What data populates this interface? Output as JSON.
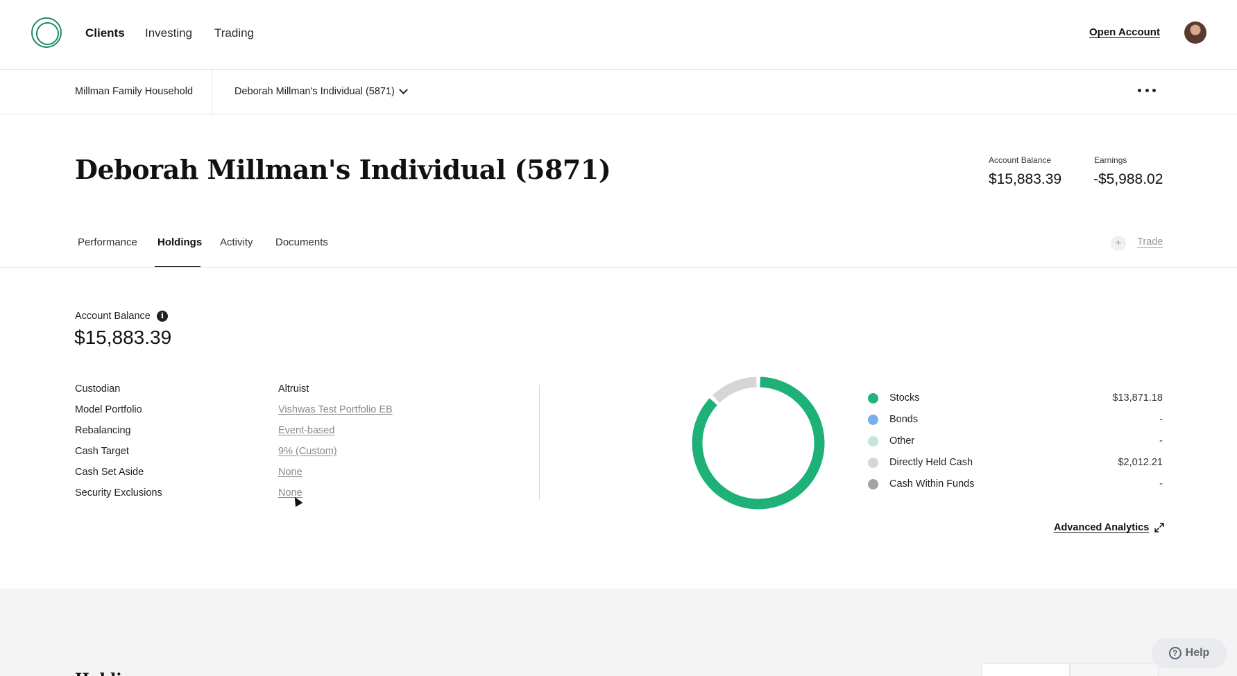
{
  "topnav": {
    "items": [
      {
        "label": "Clients",
        "active": true
      },
      {
        "label": "Investing",
        "active": false
      },
      {
        "label": "Trading",
        "active": false
      }
    ],
    "open_account": "Open Account"
  },
  "subnav": {
    "household": "Millman Family Household",
    "account": "Deborah Millman's Individual (5871)"
  },
  "header": {
    "title": "Deborah Millman's Individual (5871)",
    "account_balance_label": "Account Balance",
    "account_balance_value": "$15,883.39",
    "earnings_label": "Earnings",
    "earnings_value": "-$5,988.02"
  },
  "tabs": [
    {
      "label": "Performance",
      "active": false
    },
    {
      "label": "Holdings",
      "active": true
    },
    {
      "label": "Activity",
      "active": false
    },
    {
      "label": "Documents",
      "active": false
    }
  ],
  "trade": {
    "label": "Trade",
    "plus": "+"
  },
  "balance": {
    "label": "Account Balance",
    "value": "$15,883.39",
    "info_icon": "i"
  },
  "details": [
    {
      "label": "Custodian",
      "value": "Altruist",
      "link": false
    },
    {
      "label": "Model Portfolio",
      "value": "Vishwas Test Portfolio EB",
      "link": true
    },
    {
      "label": "Rebalancing",
      "value": "Event-based",
      "link": true
    },
    {
      "label": "Cash Target",
      "value": "9% (Custom)",
      "link": true
    },
    {
      "label": "Cash Set Aside",
      "value": "None",
      "link": true
    },
    {
      "label": "Security Exclusions",
      "value": "None",
      "link": true
    }
  ],
  "chart_data": {
    "type": "pie",
    "categories": [
      "Stocks",
      "Bonds",
      "Other",
      "Directly Held Cash",
      "Cash Within Funds"
    ],
    "values": [
      13871.18,
      0,
      0,
      2012.21,
      0
    ],
    "value_labels": [
      "$13,871.18",
      "-",
      "-",
      "$2,012.21",
      "-"
    ],
    "colors": [
      "#1fb57a",
      "#79aee8",
      "#bfe8d6",
      "#d6d6d6",
      "#a3a3a3"
    ]
  },
  "advanced_analytics": "Advanced Analytics",
  "bottom": {
    "holdings_title": "Holdings"
  },
  "help": {
    "label": "Help",
    "icon": "?"
  }
}
